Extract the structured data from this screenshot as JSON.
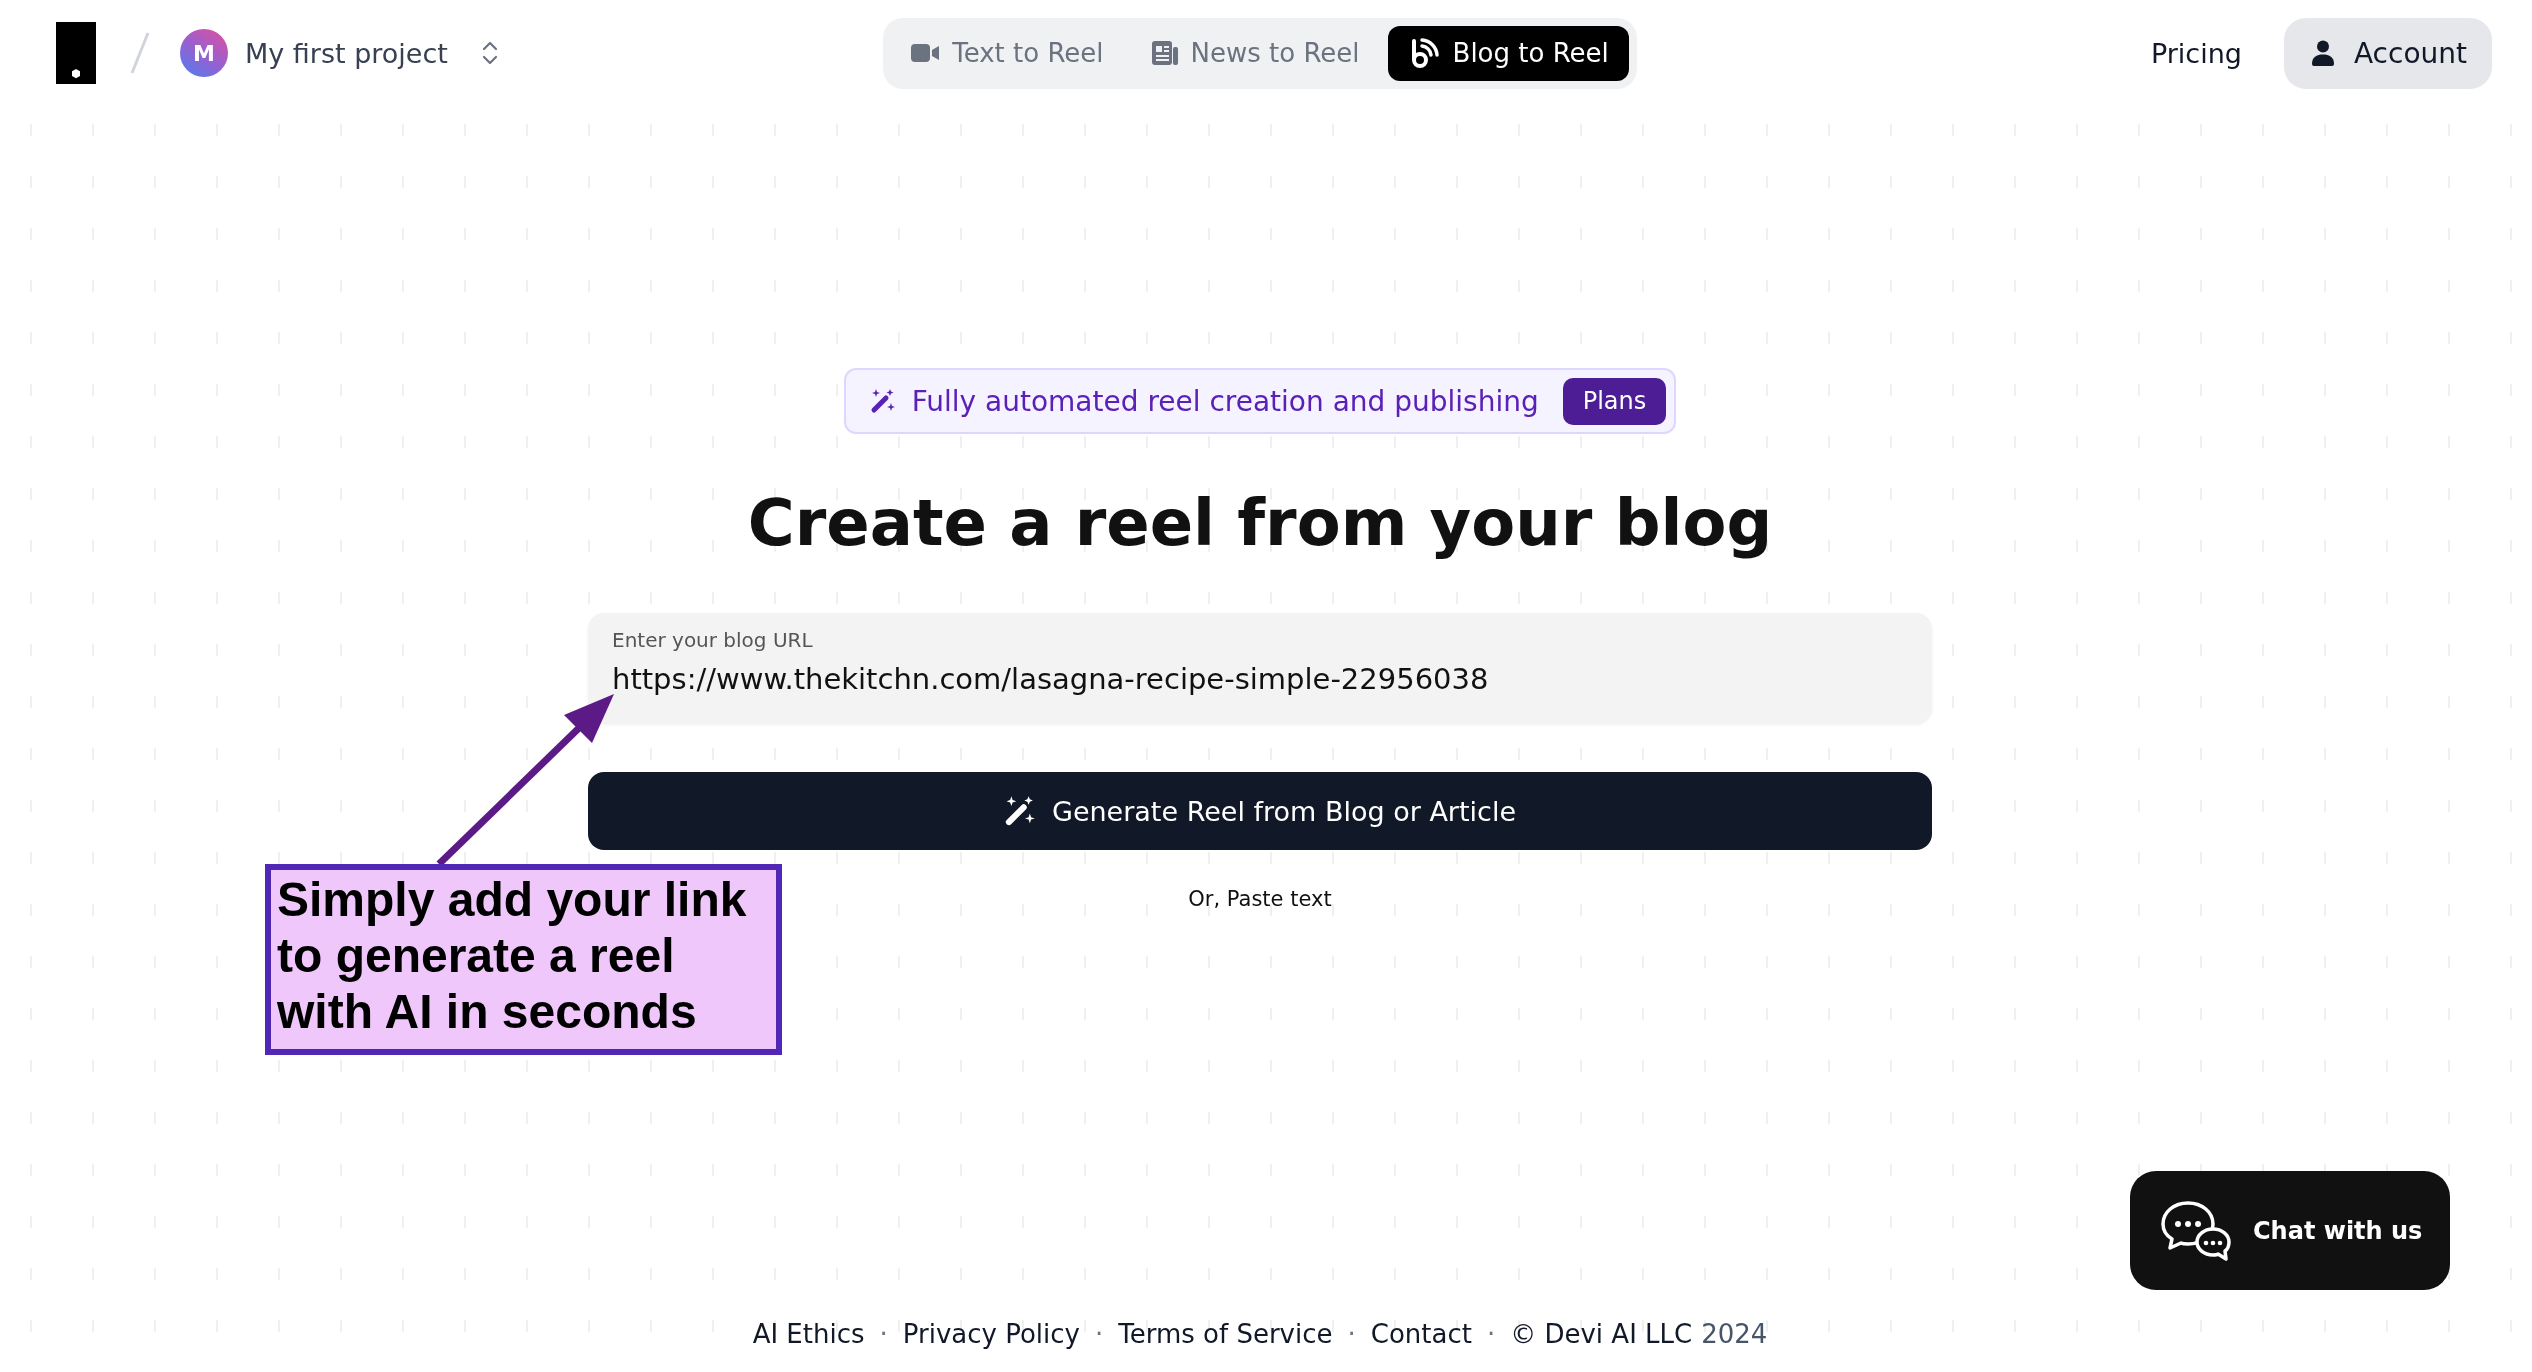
{
  "header": {
    "project": {
      "avatar_initial": "M",
      "name": "My first project"
    },
    "tabs": [
      {
        "label": "Text to Reel",
        "selected": false
      },
      {
        "label": "News to Reel",
        "selected": false
      },
      {
        "label": "Blog to Reel",
        "selected": true
      }
    ],
    "pricing_link": "Pricing",
    "account_button": "Account"
  },
  "promo": {
    "text": "Fully automated reel creation and publishing",
    "button": "Plans"
  },
  "heading": "Create a reel from your blog",
  "url_field": {
    "label": "Enter your blog URL",
    "value": "https://www.thekitchn.com/lasagna-recipe-simple-22956038"
  },
  "generate_button": "Generate Reel from Blog or Article",
  "paste_text_link": "Or, Paste text",
  "annotation": {
    "text": "Simply add your link to generate a reel with AI in seconds"
  },
  "chat_button": "Chat with us",
  "footer": {
    "items": [
      {
        "kind": "link",
        "text": "AI Ethics"
      },
      {
        "kind": "separator",
        "text": "·"
      },
      {
        "kind": "link",
        "text": "Privacy Policy"
      },
      {
        "kind": "separator",
        "text": "·"
      },
      {
        "kind": "link",
        "text": "Terms of Service"
      },
      {
        "kind": "separator",
        "text": "·"
      },
      {
        "kind": "link",
        "text": "Contact"
      },
      {
        "kind": "separator",
        "text": "·"
      },
      {
        "kind": "copyright",
        "text": "© Devi AI LLC"
      },
      {
        "kind": "year",
        "text": "2024"
      }
    ]
  }
}
